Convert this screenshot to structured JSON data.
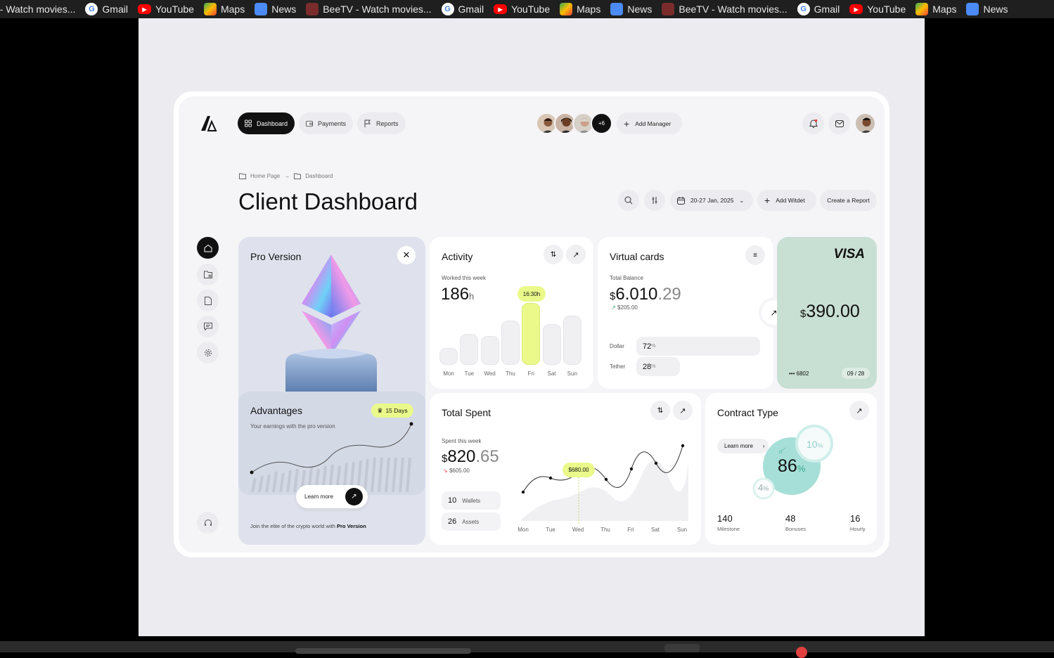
{
  "bookmarks": [
    {
      "label": "/ - Watch movies...",
      "icon": "beetv-icon"
    },
    {
      "label": "Gmail",
      "icon": "google-icon"
    },
    {
      "label": "YouTube",
      "icon": "youtube-icon"
    },
    {
      "label": "Maps",
      "icon": "maps-icon"
    },
    {
      "label": "News",
      "icon": "news-icon"
    },
    {
      "label": "BeeTV - Watch movies...",
      "icon": "beetv-icon"
    },
    {
      "label": "Gmail",
      "icon": "google-icon"
    },
    {
      "label": "YouTube",
      "icon": "youtube-icon"
    },
    {
      "label": "Maps",
      "icon": "maps-icon"
    },
    {
      "label": "News",
      "icon": "news-icon"
    },
    {
      "label": "BeeTV - Watch movies...",
      "icon": "beetv-icon"
    },
    {
      "label": "Gmail",
      "icon": "google-icon"
    },
    {
      "label": "YouTube",
      "icon": "youtube-icon"
    },
    {
      "label": "Maps",
      "icon": "maps-icon"
    },
    {
      "label": "News",
      "icon": "news-icon"
    }
  ],
  "nav": {
    "dashboard": "Dashboard",
    "payments": "Payments",
    "reports": "Reports"
  },
  "team": {
    "extra": "+6",
    "add_manager": "Add Manager"
  },
  "breadcrumb": {
    "home": "Home Page",
    "arrow": "→",
    "current": "Dashboard"
  },
  "page_title": "Client Dashboard",
  "toolbar": {
    "date_range": "20-27 Jan, 2025",
    "add_widget": "Add Witdet",
    "create_report": "Create a Report"
  },
  "pro": {
    "title": "Pro Version",
    "advantages": "Advantages",
    "days_badge": "15 Days",
    "subtitle": "Your earnings with the pro version",
    "learn_more": "Learn more",
    "footer_prefix": "Join the elite of the crypto world with ",
    "footer_bold": "Pro Version"
  },
  "activity": {
    "title": "Activity",
    "subtitle": "Worked this week",
    "value": "186",
    "unit": "h",
    "highlight": "16:30h"
  },
  "activity_chart": {
    "days": [
      "Mon",
      "Tue",
      "Wed",
      "Thu",
      "Fri",
      "Sat",
      "Sun"
    ],
    "levels": [
      0.27,
      0.5,
      0.47,
      0.72,
      1.0,
      0.66,
      0.8
    ],
    "highlight_index": 4
  },
  "virtual_cards": {
    "title": "Virtual cards",
    "total_label": "Total Balance",
    "currency": "$",
    "balance_int": "6.010",
    "balance_dec": ".29",
    "change": "$205.00",
    "rows": [
      {
        "label": "Dollar",
        "value": "72",
        "unit": "%",
        "pct": 72
      },
      {
        "label": "Tether",
        "value": "28",
        "unit": "%",
        "pct": 28
      }
    ]
  },
  "visa": {
    "brand": "VISA",
    "currency": "$",
    "amount": "390.00",
    "card_mask": "•••",
    "card_last": "6802",
    "expiry": "09 / 28",
    "bg_color": "#c8dfd3"
  },
  "total_spent": {
    "title": "Total Spent",
    "subtitle": "Spent this week",
    "currency": "$",
    "amount_int": "820",
    "amount_dec": ".65",
    "change": "$605.00",
    "wallets_count": "10",
    "wallets_label": "Wallets",
    "assets_count": "26",
    "assets_label": "Assets",
    "highlight": "$680.00"
  },
  "spent_chart": {
    "days": [
      "Mon",
      "Tue",
      "Wed",
      "Thu",
      "Fri",
      "Sat",
      "Sun"
    ],
    "highlight_index": 2
  },
  "contract": {
    "title": "Contract Type",
    "learn_more": "Learn more",
    "main_value": "86",
    "main_unit": "%",
    "secondary_value": "10",
    "secondary_unit": "%",
    "minor_value": "4",
    "minor_unit": "%",
    "stats": [
      {
        "value": "140",
        "label": "Milestone"
      },
      {
        "value": "48",
        "label": "Bonuses"
      },
      {
        "value": "16",
        "label": "Hourly"
      }
    ]
  },
  "colors": {
    "accent_lime": "#eaf98a",
    "mint": "#a6dfd8",
    "dark": "#111111"
  }
}
